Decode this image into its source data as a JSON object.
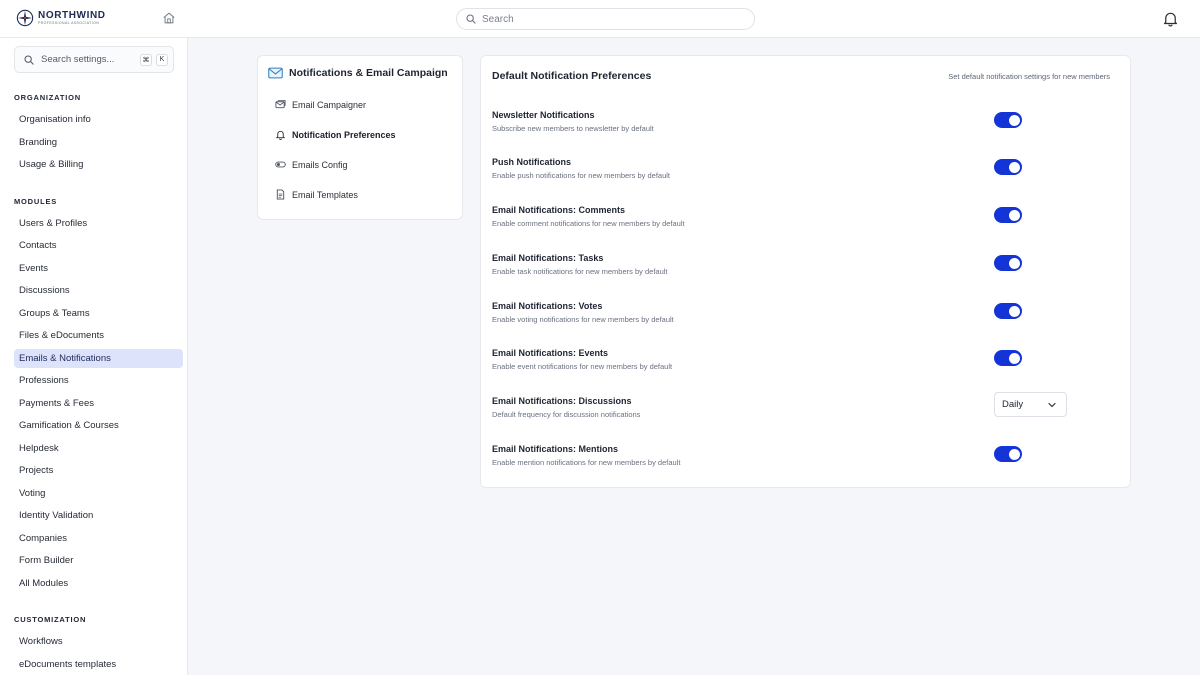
{
  "brand": {
    "name": "NORTHWIND",
    "tagline": "PROFESSIONAL ASSOCIATION"
  },
  "header": {
    "search_placeholder": "Search"
  },
  "sidebar": {
    "search_placeholder": "Search settings...",
    "shortcut_cmd": "⌘",
    "shortcut_key": "K",
    "sections": [
      {
        "title": "ORGANIZATION",
        "items": [
          "Organisation info",
          "Branding",
          "Usage & Billing"
        ]
      },
      {
        "title": "MODULES",
        "items": [
          "Users & Profiles",
          "Contacts",
          "Events",
          "Discussions",
          "Groups & Teams",
          "Files & eDocuments",
          "Emails & Notifications",
          "Professions",
          "Payments & Fees",
          "Gamification & Courses",
          "Helpdesk",
          "Projects",
          "Voting",
          "Identity Validation",
          "Companies",
          "Form Builder",
          "All Modules"
        ]
      },
      {
        "title": "CUSTOMIZATION",
        "items": [
          "Workflows",
          "eDocuments templates"
        ]
      }
    ],
    "active_item": "Emails & Notifications"
  },
  "subnav": {
    "title": "Notifications & Email Campaign",
    "items": [
      {
        "label": "Email Campaigner",
        "icon": "campaign-icon"
      },
      {
        "label": "Notification Preferences",
        "icon": "bell-icon"
      },
      {
        "label": "Emails Config",
        "icon": "toggle-icon"
      },
      {
        "label": "Email Templates",
        "icon": "document-icon"
      }
    ],
    "active_item": "Notification Preferences"
  },
  "main": {
    "title": "Default Notification Preferences",
    "description": "Set default notification settings for new members",
    "settings": [
      {
        "label": "Newsletter Notifications",
        "desc": "Subscribe new members to newsletter by default",
        "control": "toggle",
        "enabled": true
      },
      {
        "label": "Push Notifications",
        "desc": "Enable push notifications for new members by default",
        "control": "toggle",
        "enabled": true
      },
      {
        "label": "Email Notifications: Comments",
        "desc": "Enable comment notifications for new members by default",
        "control": "toggle",
        "enabled": true
      },
      {
        "label": "Email Notifications: Tasks",
        "desc": "Enable task notifications for new members by default",
        "control": "toggle",
        "enabled": true
      },
      {
        "label": "Email Notifications: Votes",
        "desc": "Enable voting notifications for new members by default",
        "control": "toggle",
        "enabled": true
      },
      {
        "label": "Email Notifications: Events",
        "desc": "Enable event notifications for new members by default",
        "control": "toggle",
        "enabled": true
      },
      {
        "label": "Email Notifications: Discussions",
        "desc": "Default frequency for discussion notifications",
        "control": "select",
        "value": "Daily"
      },
      {
        "label": "Email Notifications: Mentions",
        "desc": "Enable mention notifications for new members by default",
        "control": "toggle",
        "enabled": true
      }
    ]
  },
  "colors": {
    "accent": "#1434d6",
    "active_nav_bg": "#dde3fb",
    "page_bg": "#f5f6f9"
  }
}
